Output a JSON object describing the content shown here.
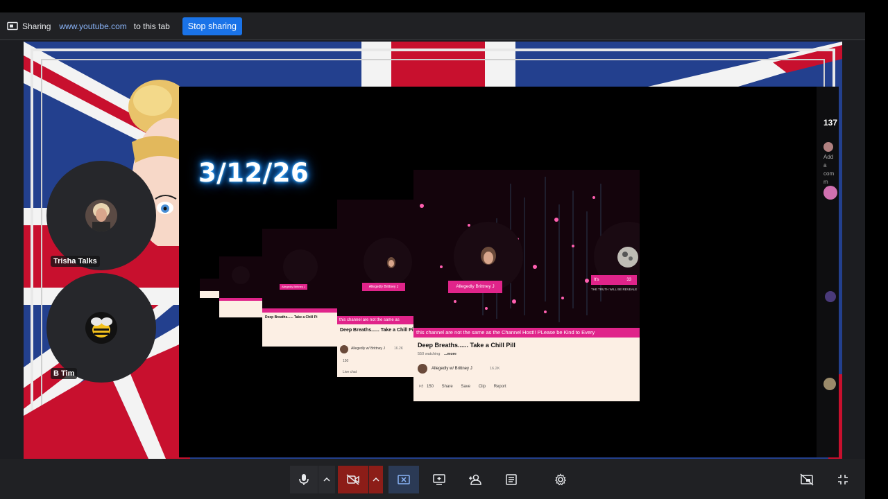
{
  "share_bar": {
    "sharing_label": "Sharing",
    "url": "www.youtube.com",
    "to_label": "to this tab",
    "stop_button": "Stop sharing"
  },
  "participants": [
    {
      "name": "Trisha Talks"
    },
    {
      "name": "B Tim"
    }
  ],
  "shared_screen": {
    "date_overlay": "3/12/26",
    "viewer_count": "137",
    "comment_placeholder": "Add a comm",
    "main_card": {
      "tag": "Allegedly Brittney J",
      "ticker": "this channel are not the same as the Channel Host!! PLease be Kind to Every",
      "title": "Deep Breaths...... Take a Chill Pill",
      "watching": "550 watching",
      "more": "...more",
      "channel": "Allegedly w/ Brittney J",
      "subs": "16.2K",
      "likes": "150",
      "actions": [
        "Share",
        "Save",
        "Clip",
        "Report"
      ],
      "side_tag": "It's",
      "side_num": "33",
      "side_text": "THE TRUTH WILL BE REVEALE"
    },
    "second_card": {
      "tag": "Allegedly Brittney J",
      "ticker": "this channel are not the same as",
      "title": "Deep Breaths...... Take a Chill Pi",
      "channel": "Allegedly w/ Brittney J",
      "subs": "16.2K",
      "likes": "150",
      "live_chat": "Live chat"
    },
    "third_card": {
      "tag": "Allegedly Brittney J",
      "title": "Deep Breaths...... Take a Chill Pi"
    }
  },
  "colors": {
    "accent_blue": "#1a73e8",
    "url_blue": "#8ab4f8",
    "bar_bg": "#202124",
    "camera_off_red": "#8c1d18",
    "present_active": "#2b3a55",
    "yt_pink": "#e0248a"
  },
  "controls": {
    "buttons": [
      "mic-icon",
      "chevron-up-icon",
      "camera-off-icon",
      "chevron-up-icon",
      "stop-present-icon",
      "present-screen-icon",
      "add-person-icon",
      "captions-icon",
      "gear-icon",
      "hide-self-view-icon",
      "exit-fullscreen-icon"
    ]
  }
}
